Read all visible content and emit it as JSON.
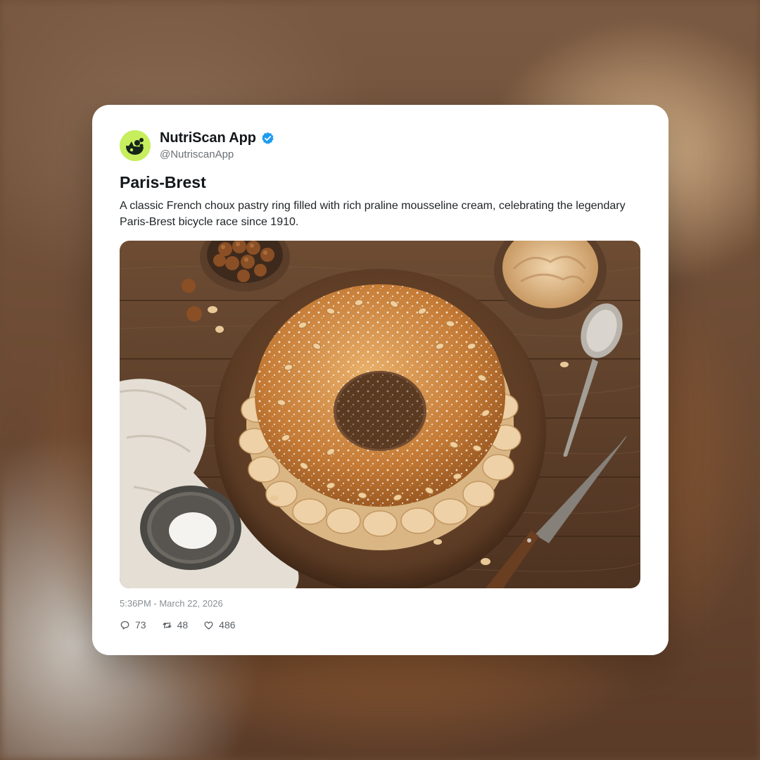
{
  "account": {
    "display_name": "NutriScan App",
    "handle": "@NutriscanApp",
    "verified": true,
    "avatar_color": "#c6ee5d"
  },
  "post": {
    "title": "Paris-Brest",
    "description": "A classic French choux pastry ring filled with rich praline mousseline cream, celebrating the legendary Paris-Brest bicycle race since 1910.",
    "timestamp": "5:36PM - March 22, 2026"
  },
  "actions": {
    "replies": "73",
    "retweets": "48",
    "likes": "486"
  },
  "icons": {
    "reply": "speech-bubble-icon",
    "retweet": "retweet-arrows-icon",
    "like": "heart-icon",
    "verified": "verified-badge-icon"
  },
  "colors": {
    "verified_blue": "#1d9bf0",
    "card_bg": "#ffffff"
  }
}
